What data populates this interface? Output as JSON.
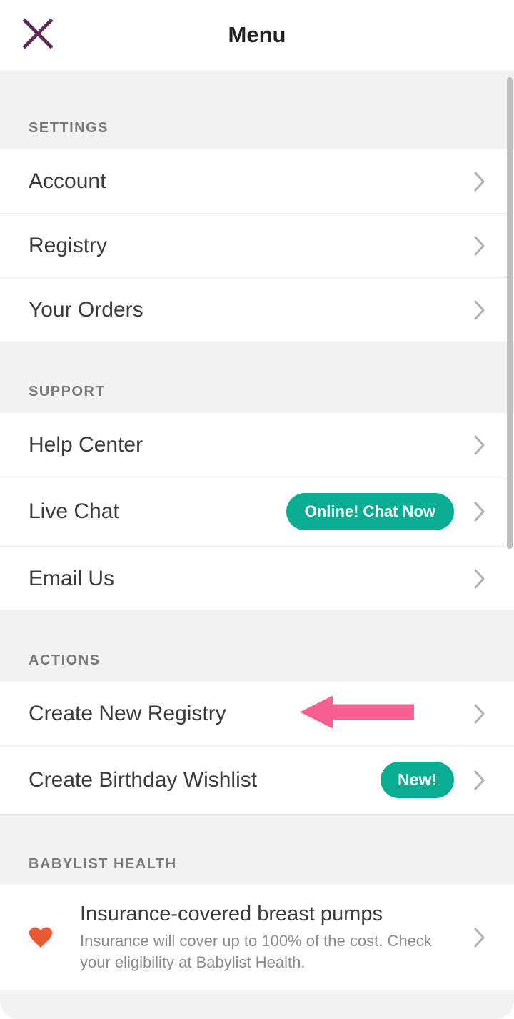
{
  "header": {
    "title": "Menu"
  },
  "sections": [
    {
      "title": "SETTINGS",
      "items": [
        {
          "label": "Account"
        },
        {
          "label": "Registry"
        },
        {
          "label": "Your Orders"
        }
      ]
    },
    {
      "title": "SUPPORT",
      "items": [
        {
          "label": "Help Center"
        },
        {
          "label": "Live Chat",
          "badge": "Online! Chat Now"
        },
        {
          "label": "Email Us"
        }
      ]
    },
    {
      "title": "ACTIONS",
      "items": [
        {
          "label": "Create New Registry"
        },
        {
          "label": "Create Birthday Wishlist",
          "badge": "New!"
        }
      ]
    },
    {
      "title": "BABYLIST HEALTH",
      "items": [
        {
          "label": "Insurance-covered breast pumps",
          "sub": "Insurance will cover up to 100% of the cost. Check your eligibility at Babylist Health."
        }
      ]
    }
  ]
}
